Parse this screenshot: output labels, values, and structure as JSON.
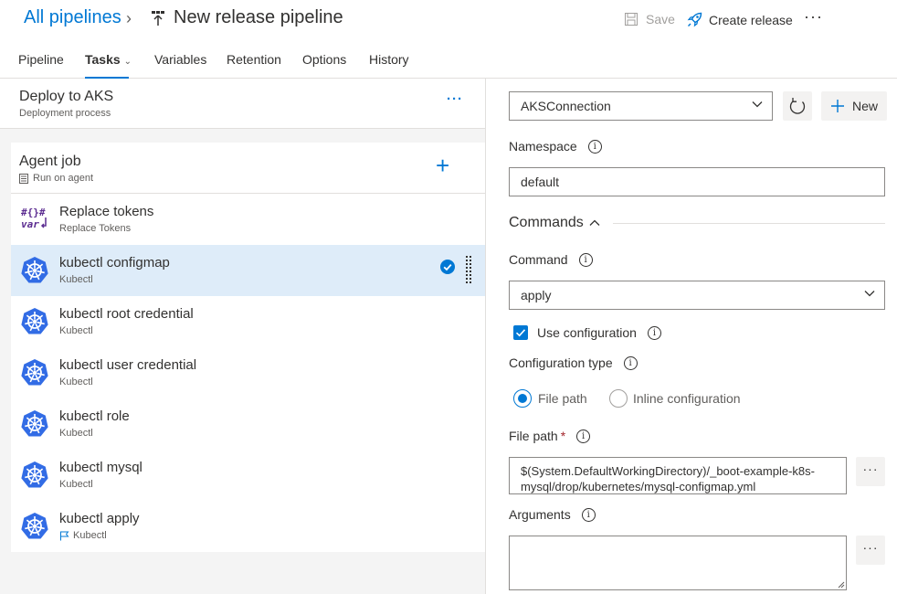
{
  "header": {
    "breadcrumb_root": "All pipelines",
    "title": "New release pipeline",
    "save_label": "Save",
    "create_release_label": "Create release",
    "more_label": "···"
  },
  "tabs": [
    {
      "label": "Pipeline"
    },
    {
      "label": "Tasks"
    },
    {
      "label": "Variables"
    },
    {
      "label": "Retention"
    },
    {
      "label": "Options"
    },
    {
      "label": "History"
    }
  ],
  "stage": {
    "title": "Deploy to AKS",
    "subtitle": "Deployment process",
    "more_label": "···"
  },
  "agent_job": {
    "title": "Agent job",
    "subtitle": "Run on agent",
    "add_label": "+"
  },
  "tasks": [
    {
      "name": "Replace tokens",
      "sub": "Replace Tokens",
      "icon": "replace-tokens-icon"
    },
    {
      "name": "kubectl configmap",
      "sub": "Kubectl",
      "icon": "kubernetes-icon",
      "selected": true
    },
    {
      "name": "kubectl root credential",
      "sub": "Kubectl",
      "icon": "kubernetes-icon"
    },
    {
      "name": "kubectl user credential",
      "sub": "Kubectl",
      "icon": "kubernetes-icon"
    },
    {
      "name": "kubectl role",
      "sub": "Kubectl",
      "icon": "kubernetes-icon"
    },
    {
      "name": "kubectl mysql",
      "sub": "Kubectl",
      "icon": "kubernetes-icon"
    },
    {
      "name": "kubectl apply",
      "sub": "Kubectl",
      "icon": "kubernetes-icon",
      "flag": true
    }
  ],
  "form": {
    "connection": {
      "value": "AKSConnection",
      "new_label": "New"
    },
    "namespace": {
      "label": "Namespace",
      "value": "default"
    },
    "section_title": "Commands",
    "command": {
      "label": "Command",
      "value": "apply"
    },
    "use_configuration": {
      "label": "Use configuration",
      "checked": true
    },
    "configuration_type": {
      "label": "Configuration type",
      "options": [
        "File path",
        "Inline configuration"
      ],
      "selected": "File path"
    },
    "file_path": {
      "label": "File path",
      "required_mark": "*",
      "value": "$(System.DefaultWorkingDirectory)/_boot-example-k8s-mysql/drop/kubernetes/mysql-configmap.yml"
    },
    "arguments": {
      "label": "Arguments",
      "value": ""
    },
    "ellipsis_label": "···",
    "info_glyph": "i"
  },
  "colors": {
    "accent": "#0078d4",
    "selected_row": "#deecf9",
    "left_bg": "#f4f4f4",
    "kubernetes": "#326ce5",
    "tokens_purple": "#5c2d91"
  }
}
